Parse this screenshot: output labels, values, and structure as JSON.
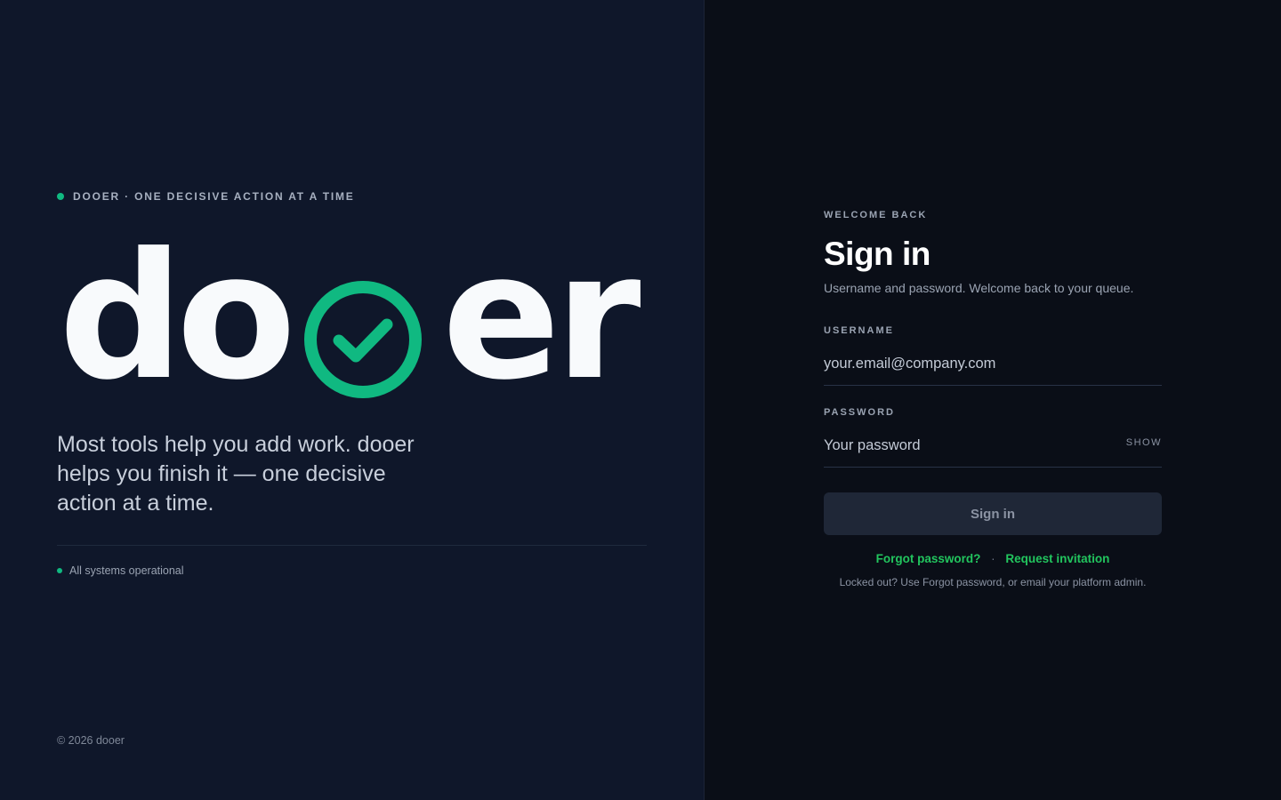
{
  "brand": {
    "eyebrow": "DOOER · ONE DECISIVE ACTION AT A TIME",
    "wordmark_left": "do",
    "wordmark_right": "er",
    "tagline": "Most tools help you add work. dooer helps you finish it — one decisive action at a time.",
    "status": "All systems operational",
    "copyright": "© 2026 dooer",
    "accent_color": "#10b981"
  },
  "signin": {
    "eyebrow": "WELCOME BACK",
    "title": "Sign in",
    "subtitle": "Username and password. Welcome back to your queue.",
    "username_label": "USERNAME",
    "username_placeholder": "your.email@company.com",
    "password_label": "PASSWORD",
    "password_placeholder": "Your password",
    "show_label": "SHOW",
    "submit_label": "Sign in",
    "forgot_label": "Forgot password?",
    "separator": "·",
    "request_label": "Request invitation",
    "help_text": "Locked out? Use Forgot password, or email your platform admin."
  },
  "icons": {
    "eyebrow_dot": "status-dot-icon",
    "wordmark_o": "check-circle-icon"
  }
}
